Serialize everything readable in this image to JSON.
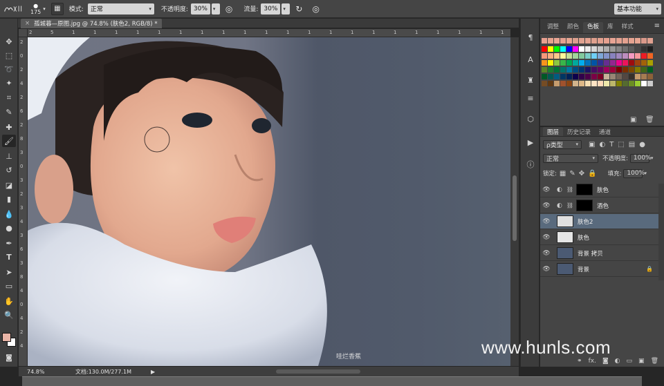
{
  "options_bar": {
    "size_value": "175",
    "mode_label": "模式:",
    "mode_value": "正常",
    "opacity_label": "不透明度:",
    "opacity_value": "30%",
    "flow_label": "流量:",
    "flow_value": "30%",
    "workspace_value": "基本功能"
  },
  "document": {
    "tab_title": "孤城暮—原图.jpg @ 74.8% (肤色2, RGB/8) *",
    "status_zoom": "74.8%",
    "status_info": "文档:130.0M/277.1M",
    "photo_caption": "哇烂香蕉"
  },
  "ruler": {
    "top_labels": [
      "2",
      "5",
      "1",
      "1",
      "1",
      "1",
      "1",
      "1",
      "1",
      "1",
      "1",
      "1",
      "1",
      "1",
      "1",
      "1",
      "1",
      "1",
      "1",
      "1",
      "1",
      "1",
      "1"
    ],
    "left_labels": [
      "2",
      "0",
      "2",
      "4",
      "2",
      "6",
      "2",
      "8",
      "3",
      "0",
      "3",
      "2",
      "3",
      "4",
      "3",
      "6",
      "3",
      "8",
      "4",
      "0",
      "4",
      "2",
      "4"
    ]
  },
  "swatches_panel": {
    "tabs": [
      "调整",
      "颜色",
      "色板",
      "库",
      "样式"
    ],
    "active_tab": "色板"
  },
  "layers_panel": {
    "tabs": [
      "图层",
      "历史记录",
      "通道"
    ],
    "active_tab": "图层",
    "filter_label": "ρ类型",
    "blend_mode": "正常",
    "opacity_label": "不透明度:",
    "opacity_value": "100%",
    "lock_label": "锁定:",
    "fill_label": "填充:",
    "fill_value": "100%",
    "layers": [
      {
        "name": "肤色",
        "selected": false,
        "locked": false
      },
      {
        "name": "酒色",
        "selected": false,
        "locked": false
      },
      {
        "name": "肤色2",
        "selected": true,
        "locked": false
      },
      {
        "name": "肤色",
        "selected": false,
        "locked": false
      },
      {
        "name": "背景 拷贝",
        "selected": false,
        "locked": false
      },
      {
        "name": "背景",
        "selected": false,
        "locked": true
      }
    ],
    "footer_fx": "fx."
  },
  "watermark": "www.hunls.com",
  "colors": {
    "foreground": "#e8b4a6",
    "background": "#ffffff",
    "selected_layer": "#596a7d"
  }
}
